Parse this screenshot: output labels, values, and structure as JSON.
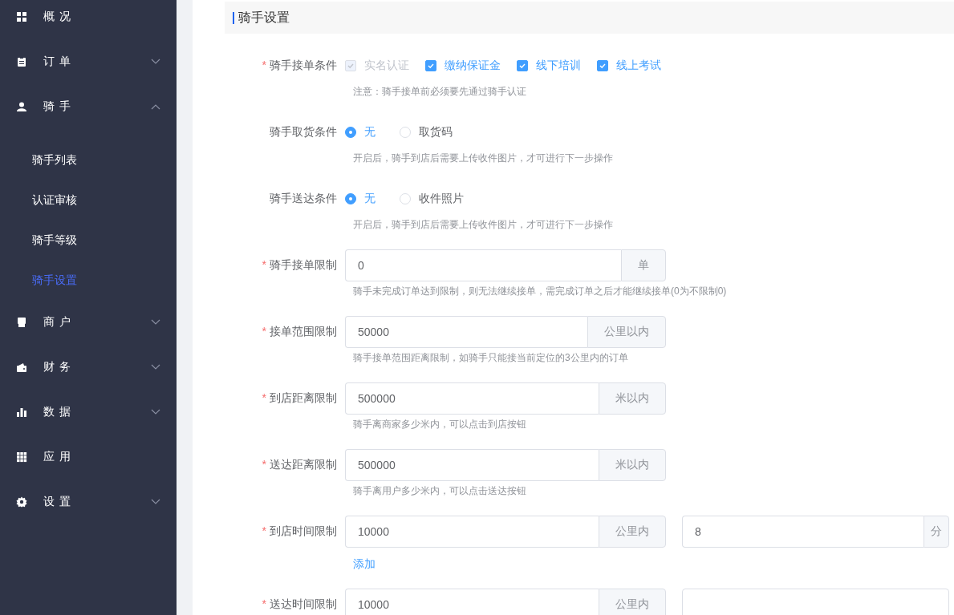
{
  "sidebar": {
    "items": [
      {
        "label": "概 况",
        "selected": false
      },
      {
        "label": "订 单",
        "selected": false,
        "expanded": false
      },
      {
        "label": "骑 手",
        "selected": false,
        "expanded": true,
        "children": [
          {
            "label": "骑手列表",
            "selected": false
          },
          {
            "label": "认证审核",
            "selected": false
          },
          {
            "label": "骑手等级",
            "selected": false
          },
          {
            "label": "骑手设置",
            "selected": true
          }
        ]
      },
      {
        "label": "商 户",
        "selected": false,
        "expanded": false
      },
      {
        "label": "财 务",
        "selected": false,
        "expanded": false
      },
      {
        "label": "数 据",
        "selected": false,
        "expanded": false
      },
      {
        "label": "应 用",
        "selected": false
      },
      {
        "label": "设 置",
        "selected": false,
        "expanded": false
      }
    ]
  },
  "section_title": "骑手设置",
  "form": {
    "rows": [
      {
        "kind": "checkboxes",
        "mark": "*",
        "label": "骑手接单条件",
        "options": [
          {
            "label": "实名认证",
            "checked": true,
            "disabled": true
          },
          {
            "label": "缴纳保证金",
            "checked": true,
            "disabled": false
          },
          {
            "label": "线下培训",
            "checked": true,
            "disabled": false
          },
          {
            "label": "线上考试",
            "checked": true,
            "disabled": false
          }
        ],
        "help": "注意：骑手接单前必须要先通过骑手认证"
      },
      {
        "kind": "radios",
        "label": "骑手取货条件",
        "options": [
          {
            "label": "无",
            "selected": true
          },
          {
            "label": "取货码",
            "selected": false
          }
        ],
        "help": "开启后，骑手到店后需要上传收件图片，才可进行下一步操作"
      },
      {
        "kind": "radios",
        "label": "骑手送达条件",
        "options": [
          {
            "label": "无",
            "selected": true
          },
          {
            "label": "收件照片",
            "selected": false
          }
        ],
        "help": "开启后，骑手到店后需要上传收件图片，才可进行下一步操作"
      },
      {
        "kind": "input",
        "mark": "*",
        "label": "骑手接单限制",
        "value": "0",
        "suffix": "单",
        "help": "骑手未完成订单达到限制，则无法继续接单，需完成订单之后才能继续接单(0为不限制0)"
      },
      {
        "kind": "input",
        "mark": "*",
        "label": "接单范围限制",
        "value": "50000",
        "suffix": "公里以内",
        "help": "骑手接单范围距离限制，如骑手只能接当前定位的3公里内的订单"
      },
      {
        "kind": "input",
        "mark": "*",
        "label": "到店距离限制",
        "value": "500000",
        "suffix": "米以内",
        "help": "骑手离商家多少米内，可以点击到店按钮"
      },
      {
        "kind": "input",
        "mark": "*",
        "label": "送达距离限制",
        "value": "500000",
        "suffix": "米以内",
        "help": "骑手离用户多少米内，可以点击送达按钮"
      },
      {
        "kind": "pair",
        "mark": "*",
        "label": "到店时间限制",
        "fields": [
          {
            "value": "10000",
            "suffix": "公里内"
          },
          {
            "value": "8",
            "suffix": "分"
          }
        ],
        "link": "添加"
      },
      {
        "kind": "pair",
        "mark": "*",
        "label": "送达时间限制",
        "fields": [
          {
            "value": "10000",
            "suffix": "公里内"
          },
          {
            "kind": "empty"
          }
        ]
      }
    ]
  }
}
